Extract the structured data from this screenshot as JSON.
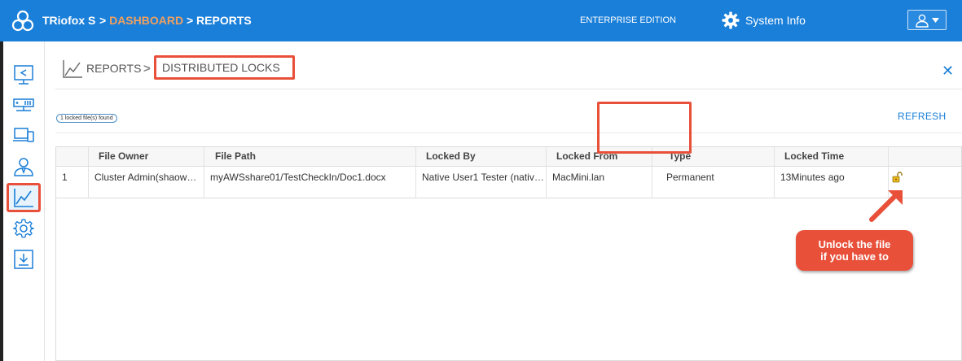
{
  "topbar": {
    "brand": "TRiofox S",
    "crumb_sep1": ">",
    "crumb_dashboard": "DASHBOARD",
    "crumb_sep2": ">",
    "crumb_reports": "REPORTS",
    "edition": "ENTERPRISE EDITION",
    "system_info": "System Info",
    "icons": {
      "logo": "triofox-logo-icon",
      "gear": "gear-icon",
      "user": "user-icon",
      "caret": "caret-down-icon"
    }
  },
  "sidebar": {
    "items": [
      {
        "name": "share-monitor-icon"
      },
      {
        "name": "server-icon"
      },
      {
        "name": "devices-icon"
      },
      {
        "name": "users-icon"
      },
      {
        "name": "reports-icon",
        "active": true
      },
      {
        "name": "settings-gear-icon"
      },
      {
        "name": "download-icon"
      }
    ]
  },
  "header": {
    "reports": "REPORTS",
    "chevron": ">",
    "current": "DISTRIBUTED LOCKS",
    "close": "✕"
  },
  "toolbar": {
    "count_badge": "1 locked file(s) found",
    "refresh": "REFRESH"
  },
  "table": {
    "columns": [
      "File Owner",
      "File Path",
      "Locked By",
      "Locked From",
      "Type",
      "Locked Time"
    ],
    "rows": [
      {
        "index": "1",
        "owner": "Cluster Admin(shaow…",
        "path": "myAWSshare01/TestCheckIn/Doc1.docx",
        "locked_by": "Native User1 Tester (nativ…",
        "locked_from": "MacMini.lan",
        "type": "Permanent",
        "locked_time": "13Minutes ago"
      }
    ]
  },
  "callout": {
    "line1": "Unlock the file",
    "line2": "if you have to"
  },
  "colors": {
    "topbar": "#1a7fd9",
    "accent_orange": "#f0a060",
    "highlight_red": "#e8503a"
  }
}
